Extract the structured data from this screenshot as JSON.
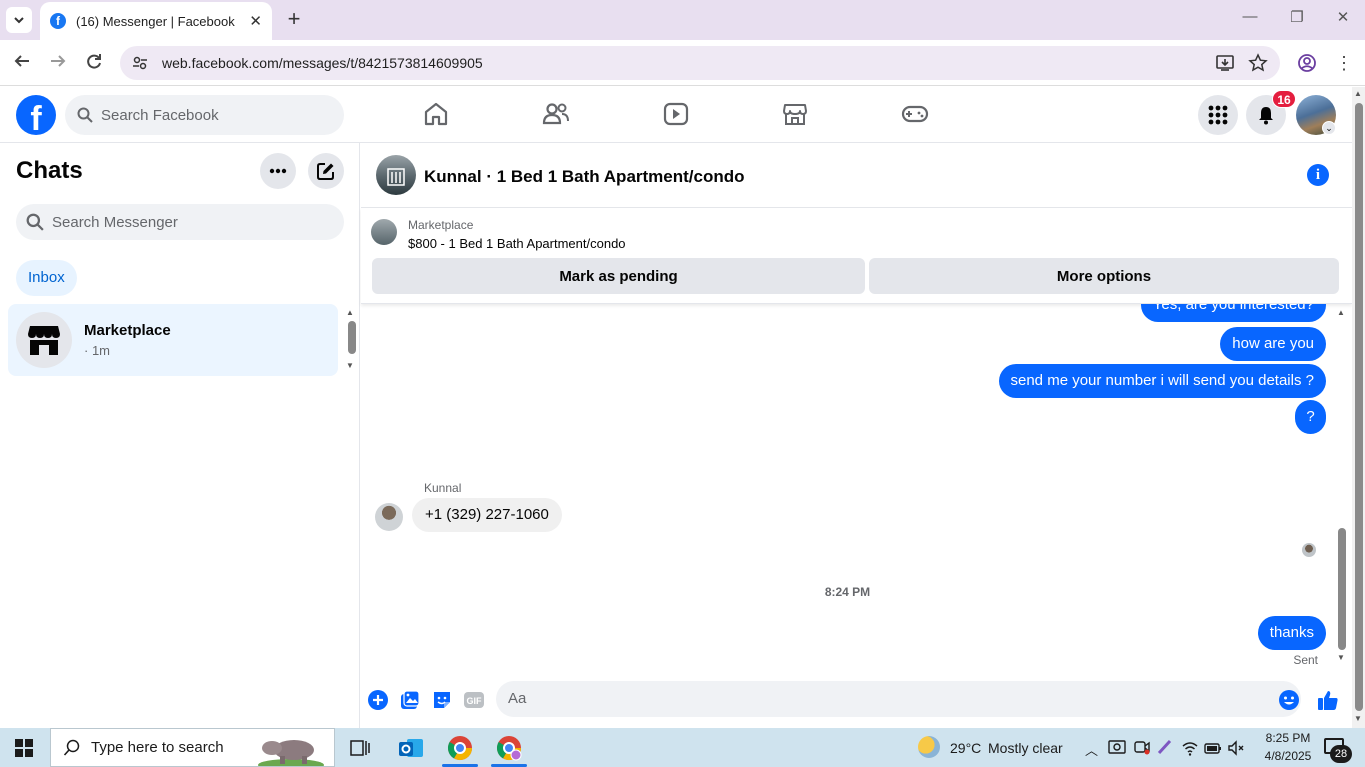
{
  "browser": {
    "tab_title": "(16) Messenger | Facebook",
    "tab_favicon": "f",
    "url": "web.facebook.com/messages/t/8421573814609905"
  },
  "fb": {
    "logo": "f",
    "search_placeholder": "Search Facebook",
    "notification_count": "16",
    "brand_color": "#0866ff"
  },
  "chats": {
    "title": "Chats",
    "search_placeholder": "Search Messenger",
    "filter_label": "Inbox",
    "items": [
      {
        "name": "Marketplace",
        "meta": "· 1m"
      }
    ]
  },
  "conversation": {
    "title": "Kunnal · 1 Bed 1 Bath Apartment/condo",
    "marketplace_label": "Marketplace",
    "listing": "$800 - 1 Bed 1 Bath Apartment/condo",
    "mark_pending_label": "Mark as pending",
    "more_options_label": "More options",
    "messages_out": [
      "Yes, are you interested?",
      "how are you",
      "send me your number i will send you details ?",
      "?"
    ],
    "sender_name": "Kunnal",
    "message_in": "+1 (329) 227-1060",
    "time_separator": "8:24 PM",
    "last_message": "thanks",
    "sent_status": "Sent",
    "composer_placeholder": "Aa"
  },
  "taskbar": {
    "search_placeholder": "Type here to search",
    "temperature": "29°C",
    "weather": "Mostly clear",
    "time": "8:25 PM",
    "date": "4/8/2025",
    "notification_count": "28"
  }
}
